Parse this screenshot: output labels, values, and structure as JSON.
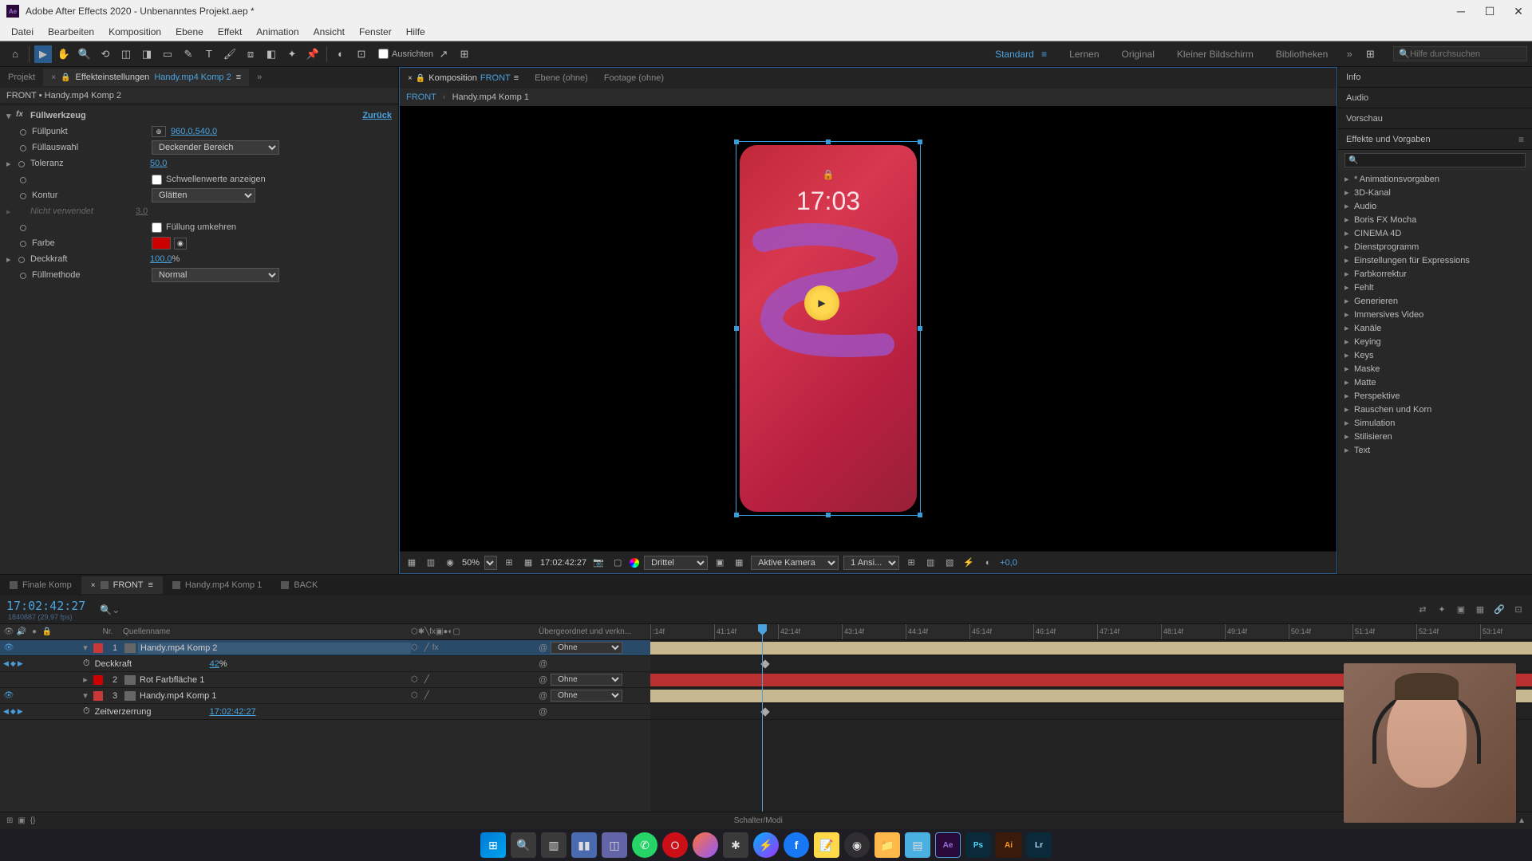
{
  "titlebar": {
    "app_icon_label": "Ae",
    "title": "Adobe After Effects 2020 - Unbenanntes Projekt.aep *"
  },
  "menu": [
    "Datei",
    "Bearbeiten",
    "Komposition",
    "Ebene",
    "Effekt",
    "Animation",
    "Ansicht",
    "Fenster",
    "Hilfe"
  ],
  "toolbar": {
    "align_label": "Ausrichten",
    "workspaces": [
      "Standard",
      "Lernen",
      "Original",
      "Kleiner Bildschirm",
      "Bibliotheken"
    ],
    "active_workspace": "Standard",
    "search_placeholder": "Hilfe durchsuchen"
  },
  "left_panel": {
    "tabs": {
      "project": "Projekt",
      "effect_controls_prefix": "Effekteinstellungen",
      "effect_controls_target": "Handy.mp4 Komp 2"
    },
    "breadcrumb": "FRONT • Handy.mp4 Komp 2",
    "effect": {
      "name": "Füllwerkzeug",
      "reset": "Zurück",
      "props": {
        "fillpoint_label": "Füllpunkt",
        "fillpoint_value": "960,0,540,0",
        "fillselect_label": "Füllauswahl",
        "fillselect_value": "Deckender Bereich",
        "tolerance_label": "Toleranz",
        "tolerance_value": "50,0",
        "threshold_label": "Schwellenwerte anzeigen",
        "contour_label": "Kontur",
        "contour_value": "Glätten",
        "notused_label": "Nicht verwendet",
        "notused_value": "3,0",
        "invertfill_label": "Füllung umkehren",
        "color_label": "Farbe",
        "opacity_label": "Deckkraft",
        "opacity_value": "100,0",
        "opacity_suffix": "%",
        "blendmode_label": "Füllmethode",
        "blendmode_value": "Normal"
      }
    }
  },
  "comp_panel": {
    "tabs": {
      "composition_prefix": "Komposition",
      "composition_name": "FRONT",
      "layer": "Ebene (ohne)",
      "footage": "Footage (ohne)"
    },
    "nav": {
      "crumb1": "FRONT",
      "crumb2": "Handy.mp4 Komp 1"
    },
    "phone": {
      "time": "17:03"
    },
    "footer": {
      "zoom": "50%",
      "timecode": "17:02:42:27",
      "resolution": "Drittel",
      "camera": "Aktive Kamera",
      "views": "1 Ansi...",
      "exposure": "+0,0"
    }
  },
  "right_panel": {
    "tabs": {
      "info": "Info",
      "audio": "Audio",
      "preview": "Vorschau",
      "effects": "Effekte und Vorgaben"
    },
    "tree": [
      "* Animationsvorgaben",
      "3D-Kanal",
      "Audio",
      "Boris FX Mocha",
      "CINEMA 4D",
      "Dienstprogramm",
      "Einstellungen für Expressions",
      "Farbkorrektur",
      "Fehlt",
      "Generieren",
      "Immersives Video",
      "Kanäle",
      "Keying",
      "Keys",
      "Maske",
      "Matte",
      "Perspektive",
      "Rauschen und Korn",
      "Simulation",
      "Stilisieren",
      "Text"
    ]
  },
  "timeline": {
    "tabs": [
      "Finale Komp",
      "FRONT",
      "Handy.mp4 Komp 1",
      "BACK"
    ],
    "active_tab": 1,
    "timecode": "17:02:42:27",
    "frames_info": "1840887 (29,97 fps)",
    "col_headers": {
      "nr": "Nr.",
      "name": "Quellenname",
      "parent": "Übergeordnet und verkn..."
    },
    "ruler_ticks": [
      ":14f",
      "41:14f",
      "42:14f",
      "43:14f",
      "44:14f",
      "45:14f",
      "46:14f",
      "47:14f",
      "48:14f",
      "49:14f",
      "50:14f",
      "51:14f",
      "52:14f",
      "53:14f"
    ],
    "layers": [
      {
        "nr": "1",
        "name": "Handy.mp4 Komp 2",
        "color": "#c83838",
        "parent": "Ohne",
        "selected": true,
        "visible": true,
        "sub": [
          {
            "label": "Deckkraft",
            "value": "42",
            "suffix": "%"
          }
        ]
      },
      {
        "nr": "2",
        "name": "Rot Farbfläche 1",
        "color": "#cc0000",
        "parent": "Ohne",
        "visible": false
      },
      {
        "nr": "3",
        "name": "Handy.mp4 Komp 1",
        "color": "#c83838",
        "parent": "Ohne",
        "visible": true,
        "sub": [
          {
            "label": "Zeitverzerrung",
            "value": "17:02:42:27"
          }
        ]
      }
    ],
    "footer_mode": "Schalter/Modi"
  },
  "taskbar": {
    "icons": [
      "windows",
      "search",
      "taskview",
      "explorer",
      "teams",
      "whatsapp",
      "opera",
      "firefox",
      "figure",
      "messenger",
      "facebook",
      "notes",
      "obs",
      "folder",
      "notepad",
      "ae",
      "ps",
      "ai",
      "lr"
    ]
  }
}
